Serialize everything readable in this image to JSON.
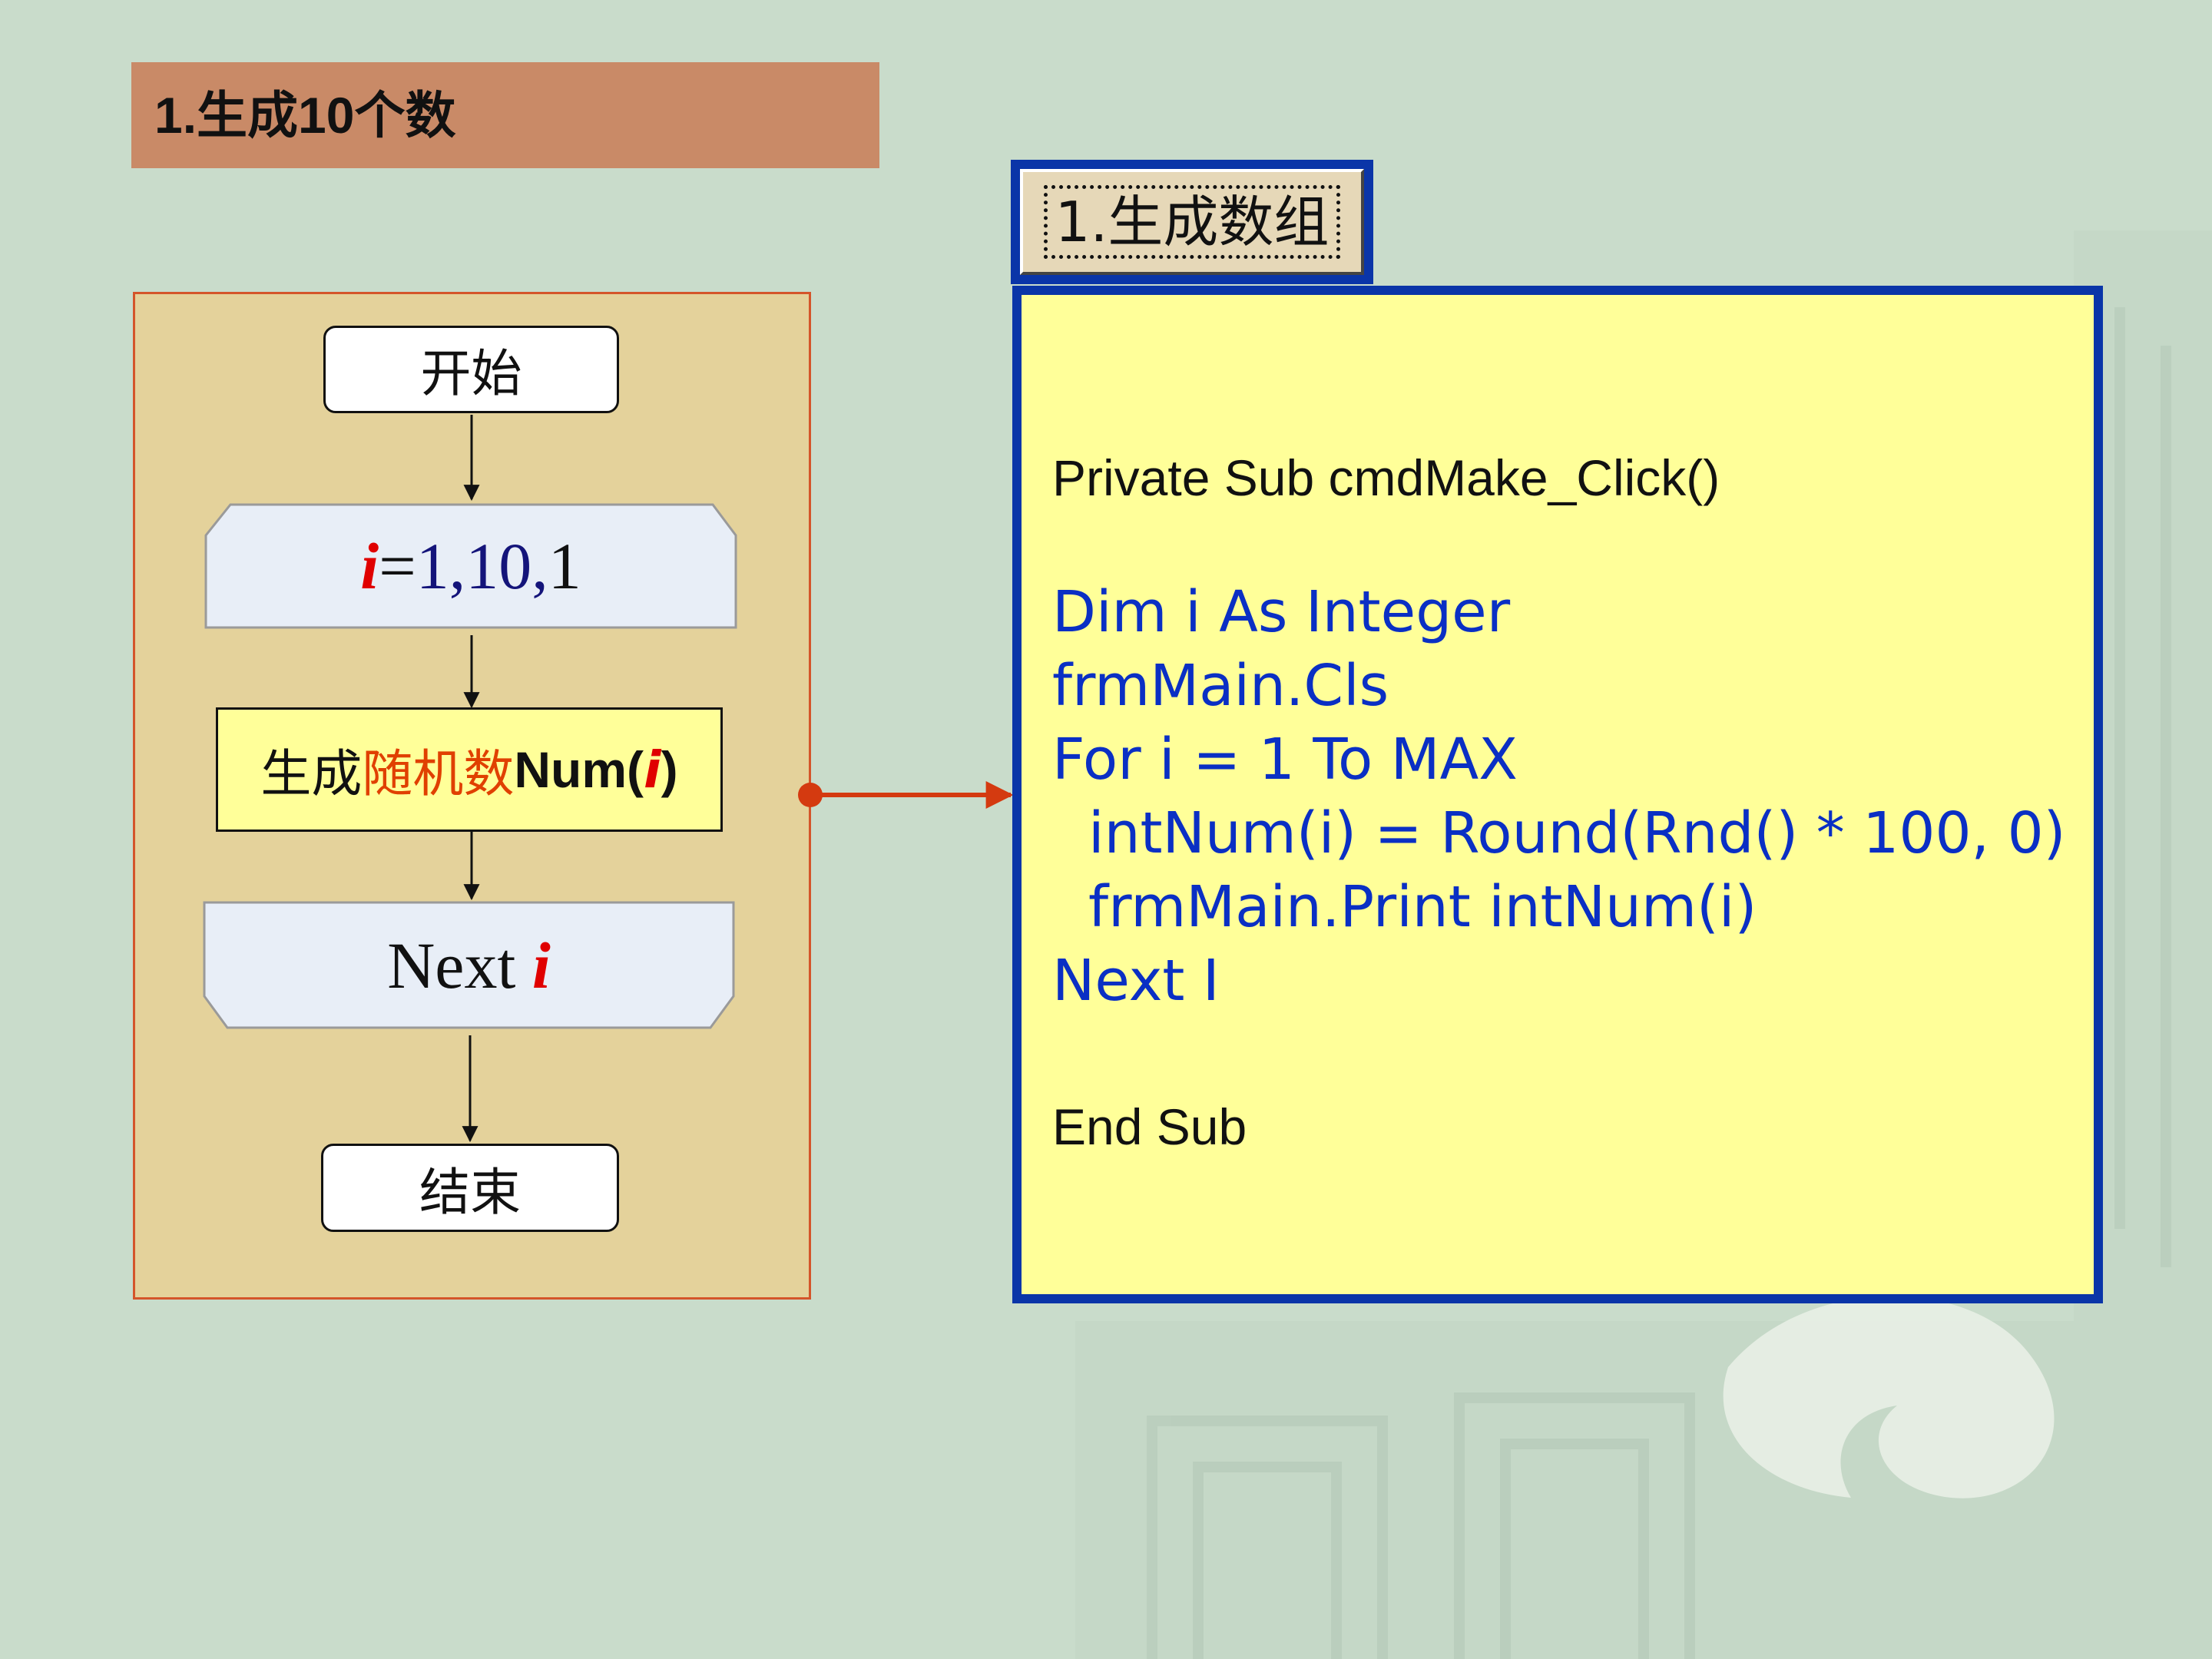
{
  "title": "1.生成10个数",
  "flowchart": {
    "start": "开始",
    "loop": {
      "var": "i",
      "eq": "=",
      "first": "1,",
      "limit": "10,",
      "step": "1"
    },
    "process": {
      "part1": "生成",
      "part2": "随机数",
      "part3": "Num(",
      "var": "i",
      "close": ")"
    },
    "next": {
      "word": "Next ",
      "var": "i"
    },
    "end": "结束"
  },
  "button": {
    "label": "1.生成数组"
  },
  "code": {
    "sub_start": "Private Sub cmdMake_Click()",
    "lines": [
      "Dim i As Integer",
      "frmMain.Cls",
      "For i = 1 To MAX",
      "  intNum(i) = Round(Rnd() * 100, 0)",
      "  frmMain.Print intNum(i)",
      "Next I"
    ],
    "sub_end": "End Sub"
  },
  "colors": {
    "background": "#c9dccb",
    "title_bar": "#c98a67",
    "flow_panel": "#e4d29b",
    "code_panel": "#ffff99",
    "code_border": "#0a35a8",
    "arrow": "#d43a10"
  }
}
